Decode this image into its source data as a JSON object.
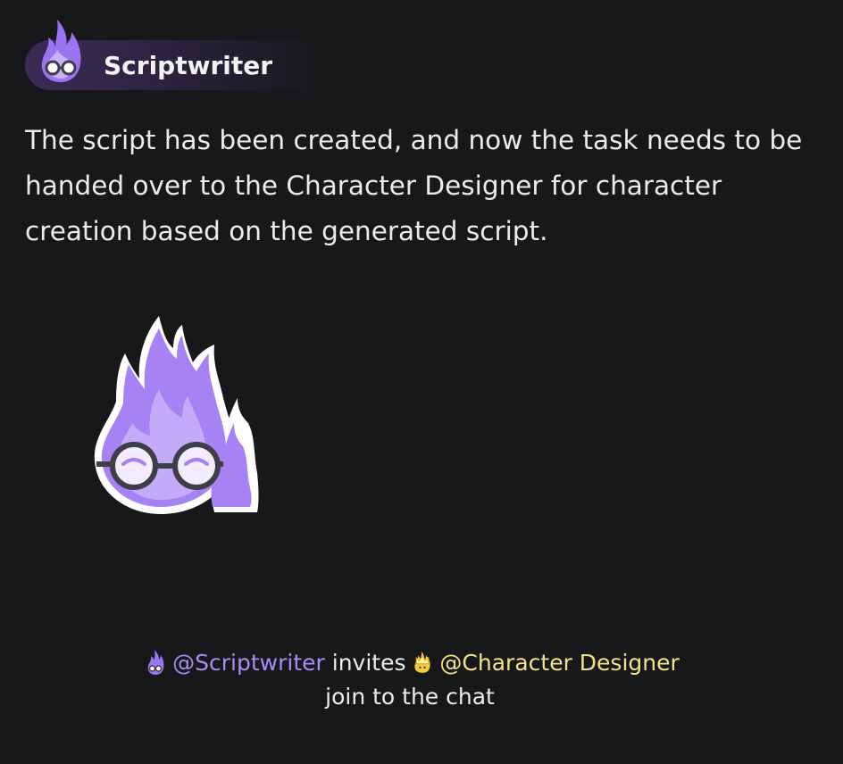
{
  "message": {
    "sender": {
      "name": "Scriptwriter",
      "avatar_icon": "purple-flame-with-glasses-icon",
      "accent": "#a98bf5"
    },
    "body": "The script has been created, and now the task needs to be handed over to the Character Designer for character creation based on the generated script.",
    "sticker": "purple-flame-with-glasses-sticker"
  },
  "invite": {
    "from_icon": "purple-flame-icon",
    "from": "@Scriptwriter",
    "verb": "invites",
    "to_icon": "yellow-crown-flame-icon",
    "to": "@Character Designer",
    "suffix": "join to the chat",
    "from_color": "#a98bf5",
    "to_color": "#f4e08a"
  }
}
